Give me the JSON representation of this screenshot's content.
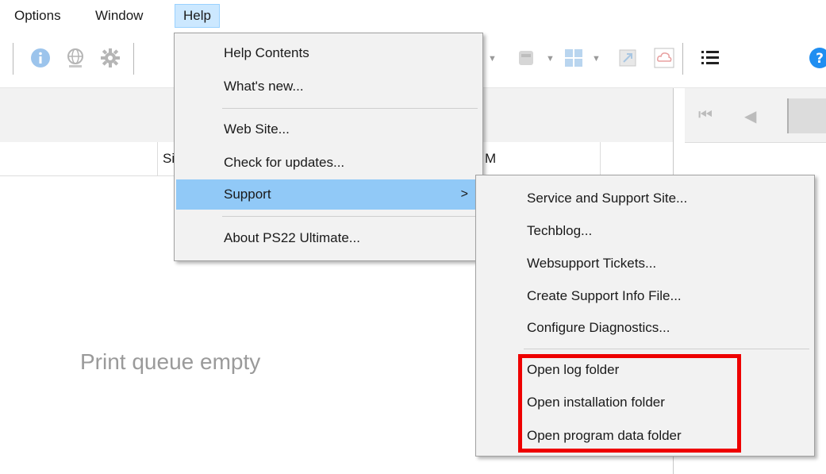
{
  "menubar": {
    "options": "Options",
    "window": "Window",
    "help": "Help"
  },
  "table_header": {
    "col_si": "Si",
    "col_m": "M"
  },
  "queue": {
    "empty_text": "Print queue empty"
  },
  "help_menu": {
    "items": [
      "Help Contents",
      "What's new...",
      "Web Site...",
      "Check for updates...",
      "Support",
      "About PS22 Ultimate..."
    ],
    "submenu_arrow": ">"
  },
  "support_menu": {
    "items": [
      "Service and Support Site...",
      "Techblog...",
      "Websupport Tickets...",
      "Create Support Info File...",
      "Configure Diagnostics...",
      "Open log folder",
      "Open installation folder",
      "Open program data folder"
    ]
  },
  "colors": {
    "highlight": "#91c9f7",
    "menu_bg": "#f2f2f2",
    "annotation_red": "#ee0000",
    "info_blue": "#1f8ef1"
  },
  "toolbar_icons": [
    "info-icon",
    "globe-icon",
    "gear-icon",
    "dropdown-icon",
    "print-icon",
    "layout-icon",
    "expand-icon",
    "cloud-icon",
    "list-icon",
    "help-icon"
  ],
  "nav_icons": [
    "first-page-icon",
    "previous-page-icon"
  ]
}
